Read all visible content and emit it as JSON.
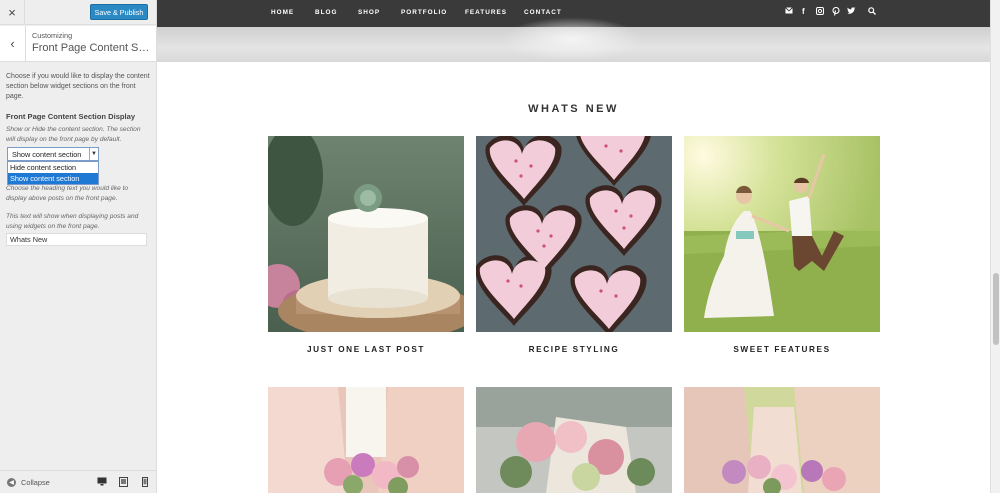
{
  "customizer": {
    "close_icon": "×",
    "save_label": "Save & Publish",
    "back_icon": "‹",
    "customizing_label": "Customizing",
    "panel_title": "Front Page Content Section",
    "intro_text": "Choose if you would like to display the content section below widget sections on the front page.",
    "section_label": "Front Page Content Section Display",
    "section_help": "Show or Hide the content section. The section will display on the front page by default.",
    "select_value": "Show content section",
    "select_options": [
      "Hide content section",
      "Show content section"
    ],
    "selected_index": 1,
    "heading_help": "Choose the heading text you would like to display above posts on the front page.",
    "text_help": "This text will show when displaying posts and using widgets on the front page.",
    "heading_value": "Whats New",
    "collapse_label": "Collapse"
  },
  "nav": {
    "items": [
      "HOME",
      "BLOG",
      "SHOP",
      "PORTFOLIO",
      "FEATURES",
      "CONTACT"
    ],
    "social_icons": [
      "email-icon",
      "facebook-icon",
      "instagram-icon",
      "pinterest-icon",
      "twitter-icon",
      "search-icon"
    ]
  },
  "section": {
    "heading": "WHATS NEW",
    "posts": [
      {
        "title": "JUST ONE LAST POST"
      },
      {
        "title": "RECIPE STYLING"
      },
      {
        "title": "SWEET FEATURES"
      }
    ]
  },
  "colors": {
    "accent": "#2b8ac4",
    "nav_bg": "#3a3a3a",
    "select_highlight": "#1e79d4"
  }
}
